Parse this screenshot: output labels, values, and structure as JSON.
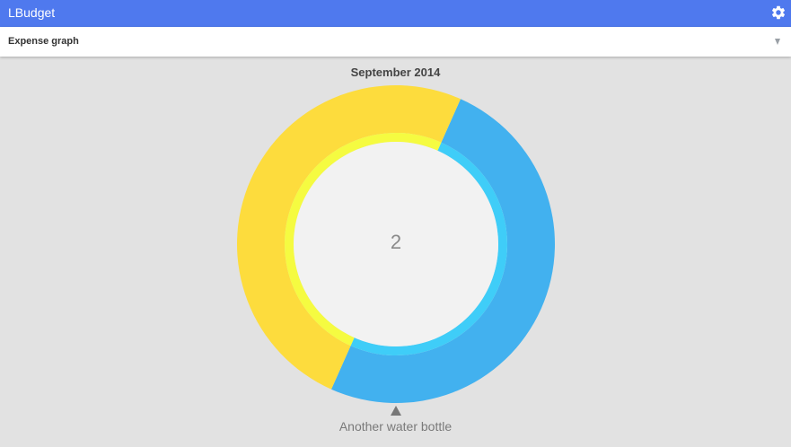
{
  "appbar": {
    "title": "LBudget",
    "settings_icon": "gear-icon"
  },
  "spinner": {
    "selected": "Expense graph",
    "arrow_icon": "dropdown-triangle-icon"
  },
  "graph": {
    "title": "September 2014",
    "center_value": "2",
    "selected_label": "Another water bottle"
  },
  "chart_data": {
    "type": "pie",
    "title": "September 2014",
    "series": [
      {
        "values": [
          50,
          50
        ]
      }
    ],
    "colors": {
      "outer": [
        "#42b1ef",
        "#fddc3d"
      ],
      "inner": [
        "#3fcdf8",
        "#f5fb41"
      ]
    },
    "center_label": "2"
  },
  "colors": {
    "appbar": "#4f79ee",
    "background": "#e2e2e2"
  }
}
